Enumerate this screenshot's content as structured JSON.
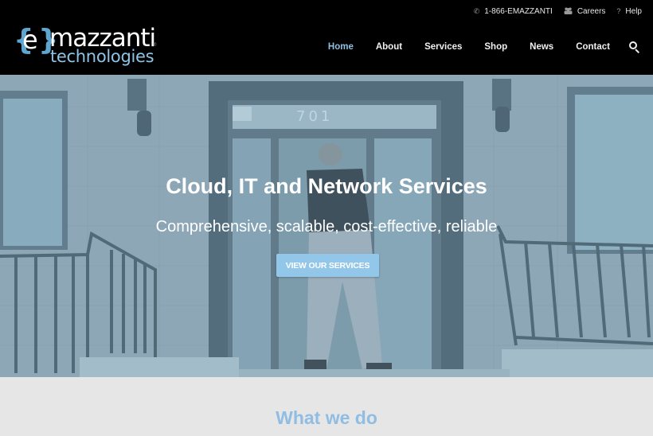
{
  "topbar": {
    "phone": {
      "icon": "phone-icon",
      "label": "1-866-EMAZZANTI"
    },
    "careers": {
      "icon": "people-icon",
      "label": "Careers"
    },
    "help": {
      "icon": "question-icon",
      "label": "Help"
    }
  },
  "logo": {
    "open_brace": "{",
    "letter": "e",
    "close_brace": "}",
    "brand": "mazzanti",
    "registered": "®",
    "subtitle": "technologies"
  },
  "nav": {
    "items": [
      {
        "label": "Home",
        "active": true
      },
      {
        "label": "About",
        "active": false
      },
      {
        "label": "Services",
        "active": false
      },
      {
        "label": "Shop",
        "active": false
      },
      {
        "label": "News",
        "active": false
      },
      {
        "label": "Contact",
        "active": false
      }
    ],
    "search_icon": "search-icon"
  },
  "hero": {
    "title": "Cloud, IT and Network Services",
    "subtitle": "Comprehensive, scalable, cost-effective, reliable",
    "button_label": "VIEW OUR SERVICES",
    "door_number": "701"
  },
  "section": {
    "title": "What we do"
  },
  "colors": {
    "accent": "#8fc0e0",
    "button": "#93c7ea",
    "header_bg": "#000000",
    "section_bg": "#e6e6e6"
  }
}
